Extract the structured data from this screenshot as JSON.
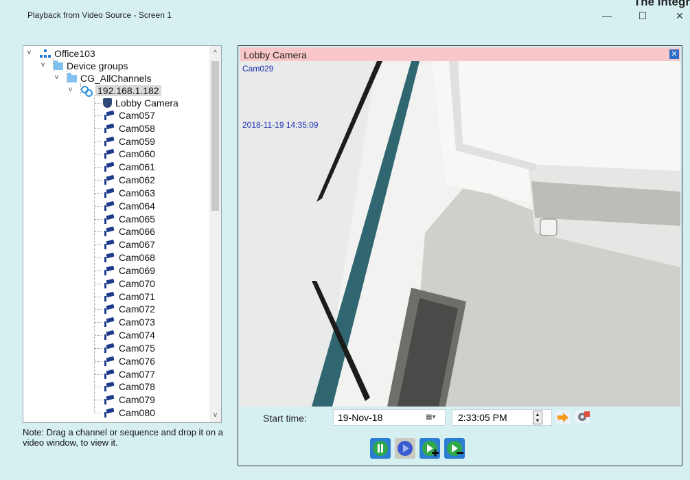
{
  "window": {
    "title": "Playback from Video Source - Screen 1",
    "corner_text": "The Integr",
    "controls": {
      "minimize": "—",
      "maximize": "☐",
      "close": "✕"
    }
  },
  "tree": {
    "root": "Office103",
    "group": "Device groups",
    "channel_group": "CG_AllChannels",
    "device": "192.168.1.182",
    "lobby_camera": "Lobby Camera",
    "cameras": [
      "Cam057",
      "Cam058",
      "Cam059",
      "Cam060",
      "Cam061",
      "Cam062",
      "Cam063",
      "Cam064",
      "Cam065",
      "Cam066",
      "Cam067",
      "Cam068",
      "Cam069",
      "Cam070",
      "Cam071",
      "Cam072",
      "Cam073",
      "Cam074",
      "Cam075",
      "Cam076",
      "Cam077",
      "Cam078",
      "Cam079",
      "Cam080"
    ]
  },
  "note": "Note: Drag a channel or sequence and drop it on a video window, to view it.",
  "viewer": {
    "title": "Lobby Camera",
    "overlay_camera": "Cam029",
    "overlay_timestamp": "2018-11-19  14:35:09"
  },
  "playback": {
    "start_label": "Start time:",
    "date": "19-Nov-18",
    "time": "2:33:05 PM"
  },
  "colors": {
    "background": "#d6f0f2",
    "header_bar": "#f9c6c9",
    "overlay_text": "#1b2fb0",
    "button_green": "#2fa84a",
    "button_blue": "#3a5ad0"
  }
}
